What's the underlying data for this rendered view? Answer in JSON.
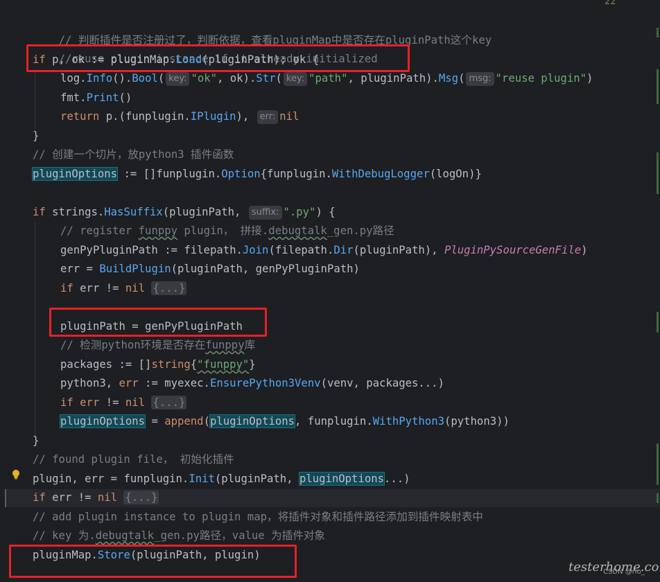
{
  "editor": {
    "top_badge": "22",
    "colors": {
      "background": "#1e1f22",
      "keyword": "#cf8e6d",
      "function": "#56a8f5",
      "string": "#6aab73",
      "comment": "#7a7e85",
      "constant": "#c77dbb",
      "highlight_box": "#e8202a"
    },
    "code": {
      "l1_comment": "// 判断插件是否注册过了，判断依据，查看pluginMap中是否存在pluginPath这个key",
      "l2_comment": "//reuse plugin instance if it already initialized",
      "l3_if": "if",
      "l3_a": " p, ok := pluginMap.",
      "l3_load": "Load",
      "l3_b": "(pluginPath); ok {",
      "l4_log": "log",
      "l4_info": "Info",
      "l4_bool": "Bool",
      "l4_hint_key": "key:",
      "l4_ok": "\"ok\"",
      "l4_mid": ", ok).",
      "l4_str": "Str",
      "l4_path": "\"path\"",
      "l4_pp": ", pluginPath).",
      "l4_msg_fn": "Msg",
      "l4_hint_msg": "msg:",
      "l4_reuse": "\"reuse plugin\"",
      "l5_fmt": "fmt",
      "l5_print": "Print",
      "l6_return": "return",
      "l6_a": " p.(funplugin.",
      "l6_iplugin": "IPlugin",
      "l6_b": "),",
      "l6_hint_err": "err:",
      "l6_nil": "nil",
      "l7": "}",
      "l8_comment": "// 创建一个切片，放python3 插件函数",
      "l9_var": "pluginOptions",
      "l9_a": " := []funplugin.",
      "l9_option": "Option",
      "l9_b": "{funplugin.",
      "l9_debug": "WithDebugLogger",
      "l9_c": "(logOn)}",
      "l11_if": "if",
      "l11_strings": " strings.",
      "l11_hassuffix": "HasSuffix",
      "l11_a": "(pluginPath,",
      "l11_hint_suffix": "suffix:",
      "l11_py": "\".py\"",
      "l11_b": ") {",
      "l12_comment_a": "// register ",
      "l12_comment_b": "funppy",
      "l12_comment_c": " plugin， 拼接.",
      "l12_comment_d": "debugtalk",
      "l12_comment_e": "_gen.py路径",
      "l13_a": "genPyPluginPath := ",
      "l13_filepath": "filepath",
      "l13_join": "Join",
      "l13_b": "(",
      "l13_dir": "Dir",
      "l13_c": "(pluginPath), ",
      "l13_const": "PluginPySourceGenFile",
      "l13_d": ")",
      "l14_a": "err = ",
      "l14_build": "BuildPlugin",
      "l14_b": "(pluginPath, genPyPluginPath)",
      "l15_if": "if",
      "l15_a": " err != ",
      "l15_nil": "nil",
      "l15_fold": "{...}",
      "l17": "pluginPath = genPyPluginPath",
      "l18_comment_a": "// 检测python环境是否存在",
      "l18_comment_b": "funppy",
      "l18_comment_c": "库",
      "l19_a": "packages := []",
      "l19_string": "string",
      "l19_b": "{",
      "l19_funppy": "\"funppy\"",
      "l19_c": "}",
      "l20_a": "python3, ",
      "l20_err": "err",
      "l20_b": " := myexec.",
      "l20_fn": "EnsurePython3Venv",
      "l20_c": "(venv, packages...)",
      "l21_if": "if",
      "l21_err": " err",
      "l21_a": " != ",
      "l21_nil": "nil",
      "l21_fold": "{...}",
      "l22_var": "pluginOptions",
      "l22_a": " = ",
      "l22_append": "append",
      "l22_b": "(",
      "l22_var2": "pluginOptions",
      "l22_c": ", funplugin.",
      "l22_withpy": "WithPython3",
      "l22_d": "(python3))",
      "l23": "}",
      "l24_comment": "// found plugin file， 初始化插件",
      "l25_a": "plugin, err = funplugin.",
      "l25_init": "Init",
      "l25_b": "(pluginPath, ",
      "l25_var": "pluginOptions",
      "l25_c": "...)",
      "l26_if": "if",
      "l26_a": " err != ",
      "l26_nil": "nil",
      "l26_fold": "{...}",
      "l27_comment": "// add plugin instance to plugin map，将插件对象和插件路径添加到插件映射表中",
      "l28_comment_a": "// key 为.",
      "l28_comment_b": "debugtalk",
      "l28_comment_c": "_gen.py路径，value 为插件对象",
      "l29_a": "pluginMap.",
      "l29_store": "Store",
      "l29_b": "(pluginPath, plugin)"
    },
    "watermark": "testerhome.com",
    "watermark_sub": "CSDN @rio_"
  }
}
